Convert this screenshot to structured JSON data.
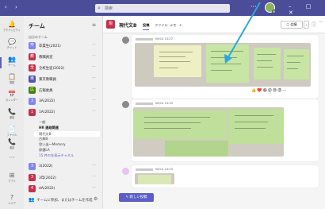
{
  "titlebar": {
    "nav": "‹ ›",
    "search_placeholder": "検索",
    "more": "···",
    "window_controls": "– □ ✕"
  },
  "rail": [
    {
      "icon": "bell-icon",
      "glyph": "🔔",
      "label": "アクティビティ"
    },
    {
      "icon": "chat-icon",
      "glyph": "💬",
      "label": "チャット"
    },
    {
      "icon": "teams-icon",
      "glyph": "👥",
      "label": "チーム"
    },
    {
      "icon": "assignments-icon",
      "glyph": "📋",
      "label": "課題"
    },
    {
      "icon": "calendar-icon",
      "glyph": "📅",
      "label": "カレンダー"
    },
    {
      "icon": "calls-icon",
      "glyph": "📞",
      "label": "通話"
    },
    {
      "icon": "files-icon",
      "glyph": "📄",
      "label": "ファイル"
    },
    {
      "icon": "call-icon",
      "glyph": "📞",
      "label": "通話"
    },
    {
      "icon": "more-apps-icon",
      "glyph": "···",
      "label": ""
    },
    {
      "icon": "apps-icon",
      "glyph": "⊞",
      "label": "アプリ"
    },
    {
      "icon": "help-icon",
      "glyph": "?",
      "label": "ヘルプ"
    }
  ],
  "teams_panel": {
    "title": "チーム",
    "filter_glyph": "≡",
    "section_label": "自分のチーム",
    "teams": [
      {
        "name": "卒業生(2021)",
        "initial": "卒",
        "color": "#7f85f5"
      },
      {
        "name": "教職員室",
        "initial": "教",
        "color": "#c4314b"
      },
      {
        "name": "全校生徒(2022)",
        "initial": "全",
        "color": "#c4314b"
      },
      {
        "name": "東京教職員",
        "initial": "東",
        "color": "#4f52b2"
      },
      {
        "name": "広報委員",
        "initial": "広",
        "color": "#498205"
      },
      {
        "name": "3A(2022)",
        "initial": "3",
        "color": "#7f85f5"
      },
      {
        "name": "1A(2022)",
        "initial": "1",
        "color": "#c4314b"
      }
    ],
    "channels": [
      {
        "name": "一般",
        "style": ""
      },
      {
        "name": "HR 連絡関連",
        "style": "bold"
      },
      {
        "name": "現代文B",
        "style": "sel"
      },
      {
        "name": "古典B",
        "style": ""
      },
      {
        "name": "思い出～Memory",
        "style": ""
      },
      {
        "name": "保健LA",
        "style": ""
      },
      {
        "name": "15 件の非表示チャネル",
        "style": "link"
      }
    ],
    "teams_after": [
      {
        "name": "3(2022)",
        "initial": "3",
        "color": "#7f85f5"
      },
      {
        "name": "3年(2022)",
        "initial": "3",
        "color": "#c4314b"
      },
      {
        "name": "4A(2022)",
        "initial": "4",
        "color": "#c4314b"
      }
    ],
    "join_text": "チームに参加、またはチームを作成",
    "settings_glyph": "⚙"
  },
  "channel": {
    "avatar_initial": "現",
    "name": "現代文B",
    "tabs": [
      "投稿",
      "ファイル",
      "メモ",
      "+"
    ],
    "meet_label": "◻ 会議",
    "meet_caret": "⌄",
    "info_glyph": "ⓘ",
    "more_glyph": "···"
  },
  "posts": [
    {
      "timestamp": "06/14 13:27",
      "image": "sticky-notes-photo-1"
    },
    {
      "timestamp": "06/14 13:33",
      "image": "sticky-notes-photo-2"
    },
    {
      "timestamp": "06/14 14:33",
      "image": "sticky-notes-photo-3"
    }
  ],
  "reactions": [
    "👍",
    "❤️",
    "😆",
    "😮",
    "😢",
    "😡",
    "···"
  ],
  "new_post_label": "✎ 新しい投稿",
  "colors": {
    "titlebar": "#4b4d99",
    "accent": "#5b5fc7",
    "note_green": "#c7e6a3",
    "note_yellow": "#f2f0a6",
    "arrow": "#2ea7e0"
  }
}
